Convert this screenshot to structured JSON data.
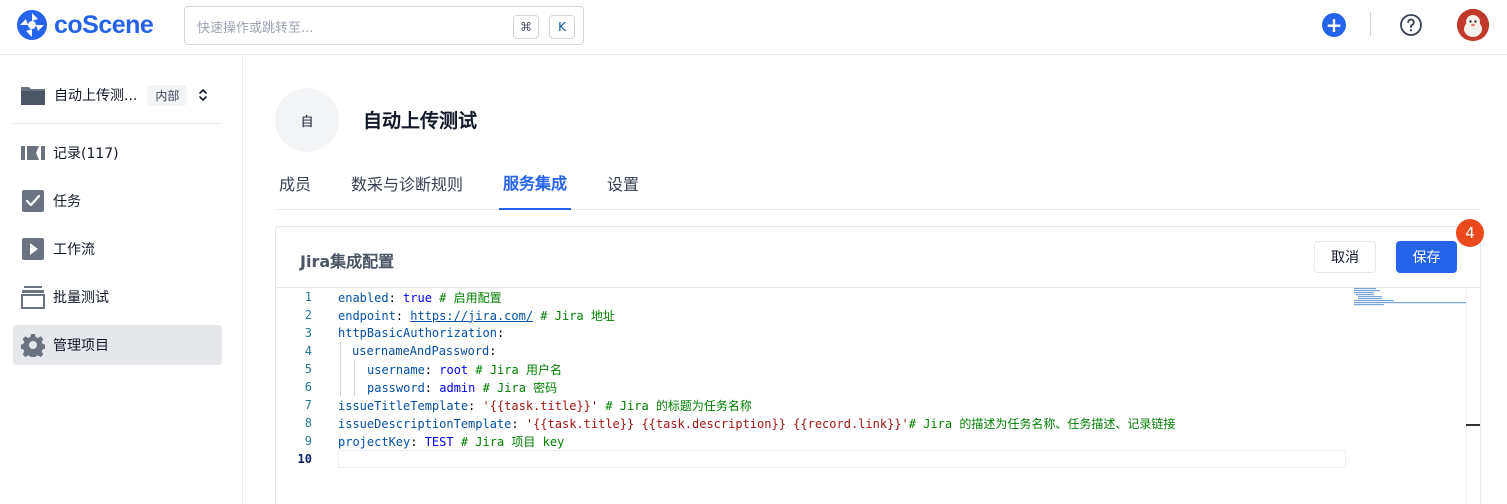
{
  "header": {
    "logo_text": "coScene",
    "search": {
      "placeholder": "快速操作或跳转至...",
      "shortcut_cmd": "⌘",
      "shortcut_key": "K"
    },
    "add_label": "+",
    "help_label": "?"
  },
  "sidebar": {
    "project": {
      "name": "自动上传测...",
      "badge": "内部"
    },
    "items": [
      {
        "label": "记录(117)",
        "icon": "records-icon"
      },
      {
        "label": "任务",
        "icon": "task-check-icon"
      },
      {
        "label": "工作流",
        "icon": "workflow-play-icon"
      },
      {
        "label": "批量测试",
        "icon": "batch-test-icon"
      },
      {
        "label": "管理项目",
        "icon": "gear-icon",
        "active": true
      }
    ]
  },
  "main": {
    "avatar_text": "自",
    "title": "自动上传测试",
    "tabs": [
      {
        "label": "成员"
      },
      {
        "label": "数采与诊断规则"
      },
      {
        "label": "服务集成",
        "active": true
      },
      {
        "label": "设置"
      }
    ],
    "card": {
      "title": "Jira集成配置",
      "cancel_label": "取消",
      "save_label": "保存",
      "notification_count": "4"
    },
    "editor": {
      "line_numbers": [
        "1",
        "2",
        "3",
        "4",
        "5",
        "6",
        "7",
        "8",
        "9",
        "10"
      ],
      "lines": [
        {
          "key": "enabled",
          "sep": ": ",
          "value": "true",
          "comment": " # 启用配置"
        },
        {
          "key": "endpoint",
          "sep": ": ",
          "url": "https://jira.com/",
          "comment": " # Jira 地址"
        },
        {
          "key": "httpBasicAuthorization",
          "sep": ":"
        },
        {
          "key": "usernameAndPassword",
          "sep": ":"
        },
        {
          "key": "username",
          "sep": ": ",
          "value": "root",
          "comment": " # Jira 用户名"
        },
        {
          "key": "password",
          "sep": ": ",
          "value": "admin",
          "comment": " # Jira 密码"
        },
        {
          "key": "issueTitleTemplate",
          "sep": ": ",
          "string": "'{{task.title}}'",
          "comment": " # Jira 的标题为任务名称"
        },
        {
          "key": "issueDescriptionTemplate",
          "sep": ": ",
          "string": "'{{task.title}} {{task.description}} {{record.link}}'",
          "comment": "# Jira 的描述为任务名称、任务描述、记录链接"
        },
        {
          "key": "projectKey",
          "sep": ": ",
          "value": "TEST",
          "comment": " # Jira 项目 key"
        }
      ]
    }
  },
  "colors": {
    "brand": "#2563eb",
    "badge": "#ea4a1c",
    "yaml_key": "#0451a5",
    "yaml_comment": "#008000",
    "yaml_string": "#a31515"
  }
}
